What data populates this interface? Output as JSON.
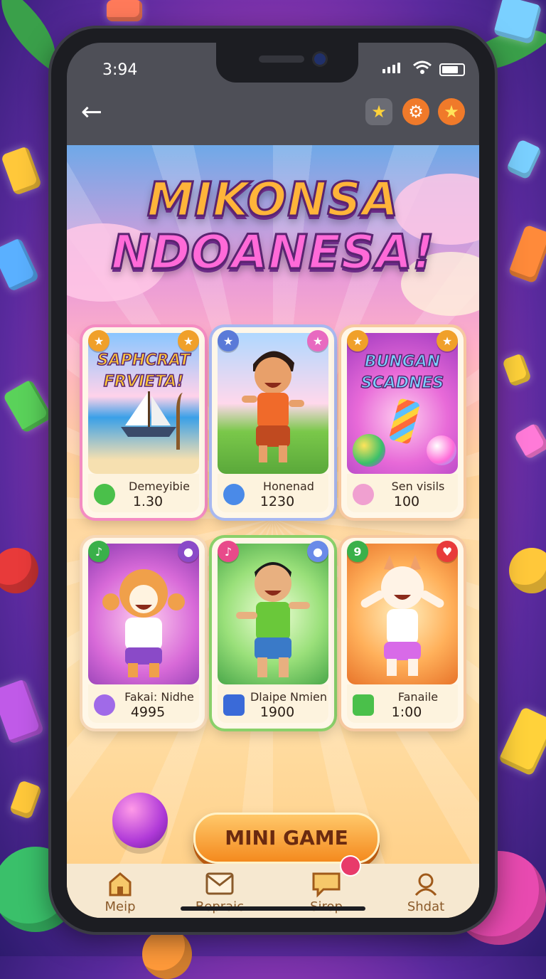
{
  "status_bar": {
    "time": "3:94"
  },
  "top_bar": {
    "back_icon": "back-arrow-icon",
    "buttons": [
      "star-icon",
      "settings-gear-icon",
      "star-badge-icon"
    ]
  },
  "logo": {
    "line1": "MIKONSA",
    "line2": "NDOANESA!"
  },
  "cards": [
    {
      "art_title": "SAPНCRAT FRVIETA!",
      "name": "Demeyibie",
      "value": "1.30",
      "icon": "green-balloon-icon",
      "accent": "#f48cc2"
    },
    {
      "art_title": "",
      "name": "Honenad",
      "value": "1230",
      "icon": "star-shield-icon",
      "accent": "#a8b8f0"
    },
    {
      "art_title": "BUNGAN SCADNES",
      "name": "Sen visils",
      "value": "100",
      "icon": "heart-candy-icon",
      "accent": "#f6c8a0"
    },
    {
      "art_title": "",
      "name": "Fakai: Nidhe",
      "value": "4995",
      "icon": "gem-badge-icon",
      "accent": "#f6d8b8"
    },
    {
      "art_title": "",
      "name": "Dlaipe Nmien",
      "value": "1900",
      "icon": "blue-gem-icon",
      "accent": "#8ad06a"
    },
    {
      "art_title": "",
      "name": "Fanaile",
      "value": "1:00",
      "icon": "green-candy-icon",
      "accent": "#f6c8a0"
    }
  ],
  "mini_game": {
    "label": "MINI GAME"
  },
  "nav": [
    {
      "label": "Meip",
      "icon": "home-icon"
    },
    {
      "label": "Bepraic",
      "icon": "mail-icon"
    },
    {
      "label": "Sirop",
      "icon": "chat-icon"
    },
    {
      "label": "Shdat",
      "icon": "profile-icon"
    }
  ],
  "colors": {
    "accent": "#f48a1e",
    "nav_text": "#8a5a2a",
    "title_orange": "#ffb43a",
    "title_pink": "#ff6ad8"
  }
}
